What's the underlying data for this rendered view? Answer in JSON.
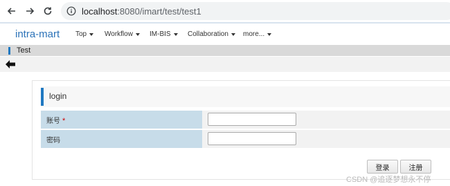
{
  "browser": {
    "url_host": "localhost",
    "url_path": ":8080/imart/test/test1"
  },
  "header": {
    "brand": "intra-mart",
    "menus": [
      {
        "label": "Top"
      },
      {
        "label": "Workflow"
      },
      {
        "label": "IM-BIS"
      },
      {
        "label": "Collaboration"
      },
      {
        "label": "more..."
      }
    ]
  },
  "page": {
    "title": "Test"
  },
  "form": {
    "title": "login",
    "fields": [
      {
        "label": "账号",
        "required_mark": "*",
        "value": ""
      },
      {
        "label": "密码",
        "value": ""
      }
    ],
    "login_button": "登录",
    "register_button": "注册"
  },
  "watermark": "CSDN @追逐梦想永不停",
  "colors": {
    "brand": "#2b72b8",
    "accent": "#1f78c1",
    "label_cell": "#c7dce9"
  }
}
